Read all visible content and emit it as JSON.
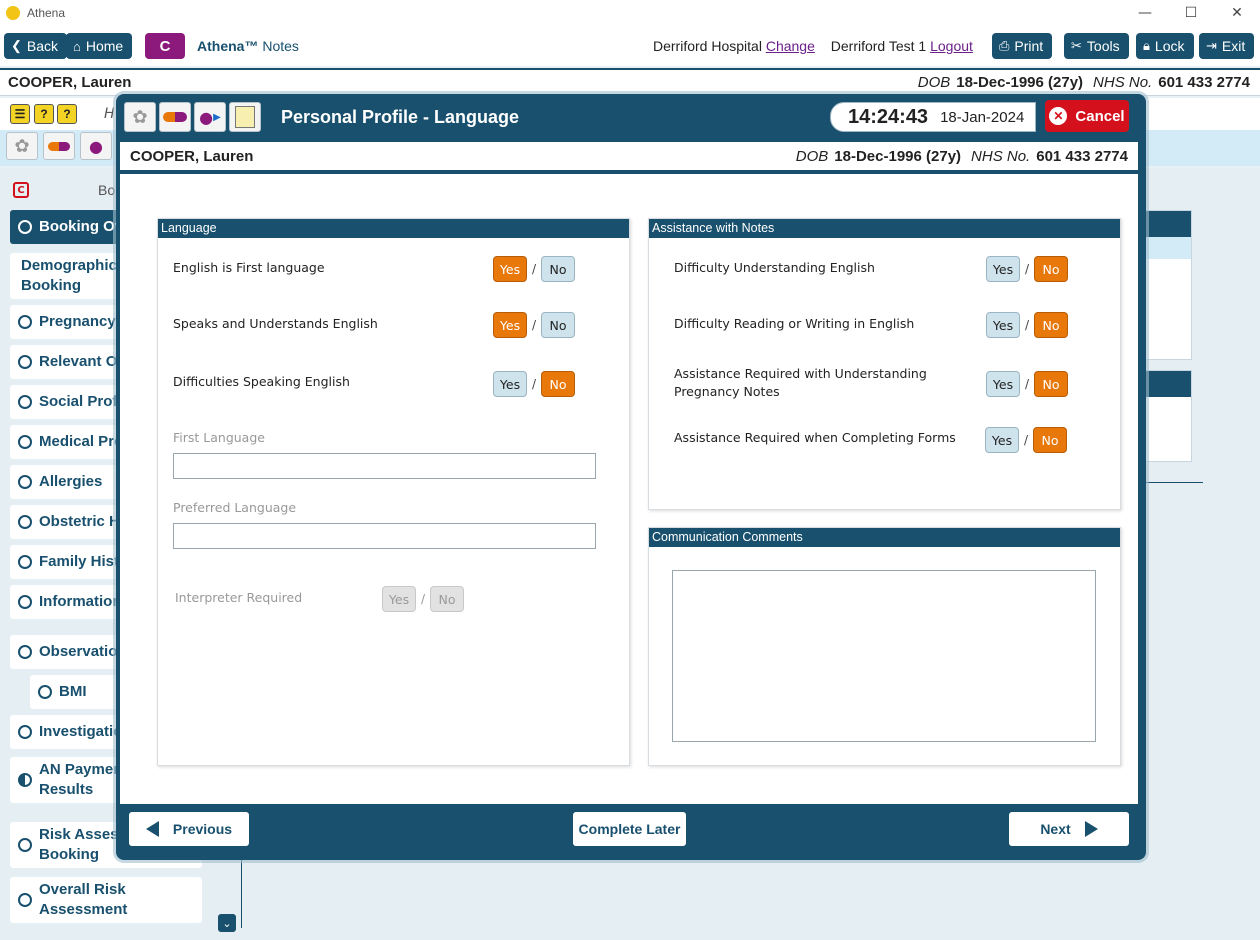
{
  "window": {
    "title": "Athena",
    "minimize": "—",
    "maximize": "☐",
    "close": "✕"
  },
  "toolbar": {
    "back": "Back",
    "home": "Home",
    "c_label": "C",
    "brand": "Athena™",
    "brand_sub": "Notes",
    "hospital": "Derriford Hospital",
    "change": "Change",
    "user": "Derriford Test 1",
    "logout": "Logout",
    "print": "Print",
    "tools": "Tools",
    "lock": "Lock",
    "exit": "Exit"
  },
  "patient": {
    "name": "COOPER, Lauren",
    "dob_label": "DOB",
    "dob": "18-Dec-1996 (27y)",
    "nhs_label": "NHS No.",
    "nhs": "601 433 2774"
  },
  "background": {
    "header_fragment": "H",
    "sidebar_header": "Bo",
    "sidebar": [
      {
        "label": "Booking Ov",
        "state": "active"
      },
      {
        "label": "Demographics Booking",
        "line1": "Demographics",
        "line2": "Booking",
        "state": "none"
      },
      {
        "label": "Pregnancy I",
        "state": "empty"
      },
      {
        "label": "Relevant Ot",
        "state": "empty"
      },
      {
        "label": "Social Profil",
        "state": "empty"
      },
      {
        "label": "Medical Pro",
        "state": "empty"
      },
      {
        "label": "Allergies",
        "state": "empty"
      },
      {
        "label": "Obstetric H",
        "state": "empty"
      },
      {
        "label": "Family Histo",
        "state": "empty"
      },
      {
        "label": "Information",
        "state": "empty"
      },
      {
        "label": "Observation",
        "state": "empty"
      },
      {
        "label": "BMI",
        "state": "empty"
      },
      {
        "label": "Investigatio",
        "state": "empty"
      },
      {
        "label": "AN Paymen Results",
        "line1": "AN Paymen",
        "line2": "Results",
        "state": "half"
      },
      {
        "label": "Risk Assessi Booking",
        "line1": "Risk Assessi",
        "line2": "Booking",
        "state": "empty"
      },
      {
        "label": "Overall Risk Assessment",
        "line1": "Overall Risk",
        "line2": "Assessment",
        "state": "empty"
      }
    ]
  },
  "modal": {
    "title": "Personal Profile - Language",
    "time": "14:24:43",
    "date": "18-Jan-2024",
    "cancel": "Cancel",
    "language_panel": {
      "title": "Language",
      "questions": [
        {
          "label": "English is First language",
          "yes": "Yes",
          "no": "No",
          "selected": "yes"
        },
        {
          "label": "Speaks and Understands English",
          "yes": "Yes",
          "no": "No",
          "selected": "yes"
        },
        {
          "label": "Difficulties Speaking English",
          "yes": "Yes",
          "no": "No",
          "selected": "no"
        }
      ],
      "first_language_label": "First Language",
      "first_language_value": "",
      "preferred_language_label": "Preferred Language",
      "preferred_language_value": "",
      "interpreter_label": "Interpreter Required",
      "interpreter_yes": "Yes",
      "interpreter_no": "No"
    },
    "assistance_panel": {
      "title": "Assistance with Notes",
      "questions": [
        {
          "label": "Difficulty Understanding English",
          "yes": "Yes",
          "no": "No",
          "selected": "no"
        },
        {
          "label": "Difficulty Reading or Writing in English",
          "yes": "Yes",
          "no": "No",
          "selected": "no"
        },
        {
          "label_line1": "Assistance Required with Understanding",
          "label_line2": "Pregnancy Notes",
          "yes": "Yes",
          "no": "No",
          "selected": "no"
        },
        {
          "label": "Assistance Required when Completing Forms",
          "yes": "Yes",
          "no": "No",
          "selected": "no"
        }
      ]
    },
    "comments_panel": {
      "title": "Communication Comments",
      "value": ""
    },
    "footer": {
      "previous": "Previous",
      "complete_later": "Complete Later",
      "next": "Next"
    }
  },
  "colors": {
    "primary": "#18506e",
    "selected": "#e8780a",
    "unselected": "#cfe3ec",
    "cancel": "#d4101c",
    "purple": "#8c1a7c"
  }
}
